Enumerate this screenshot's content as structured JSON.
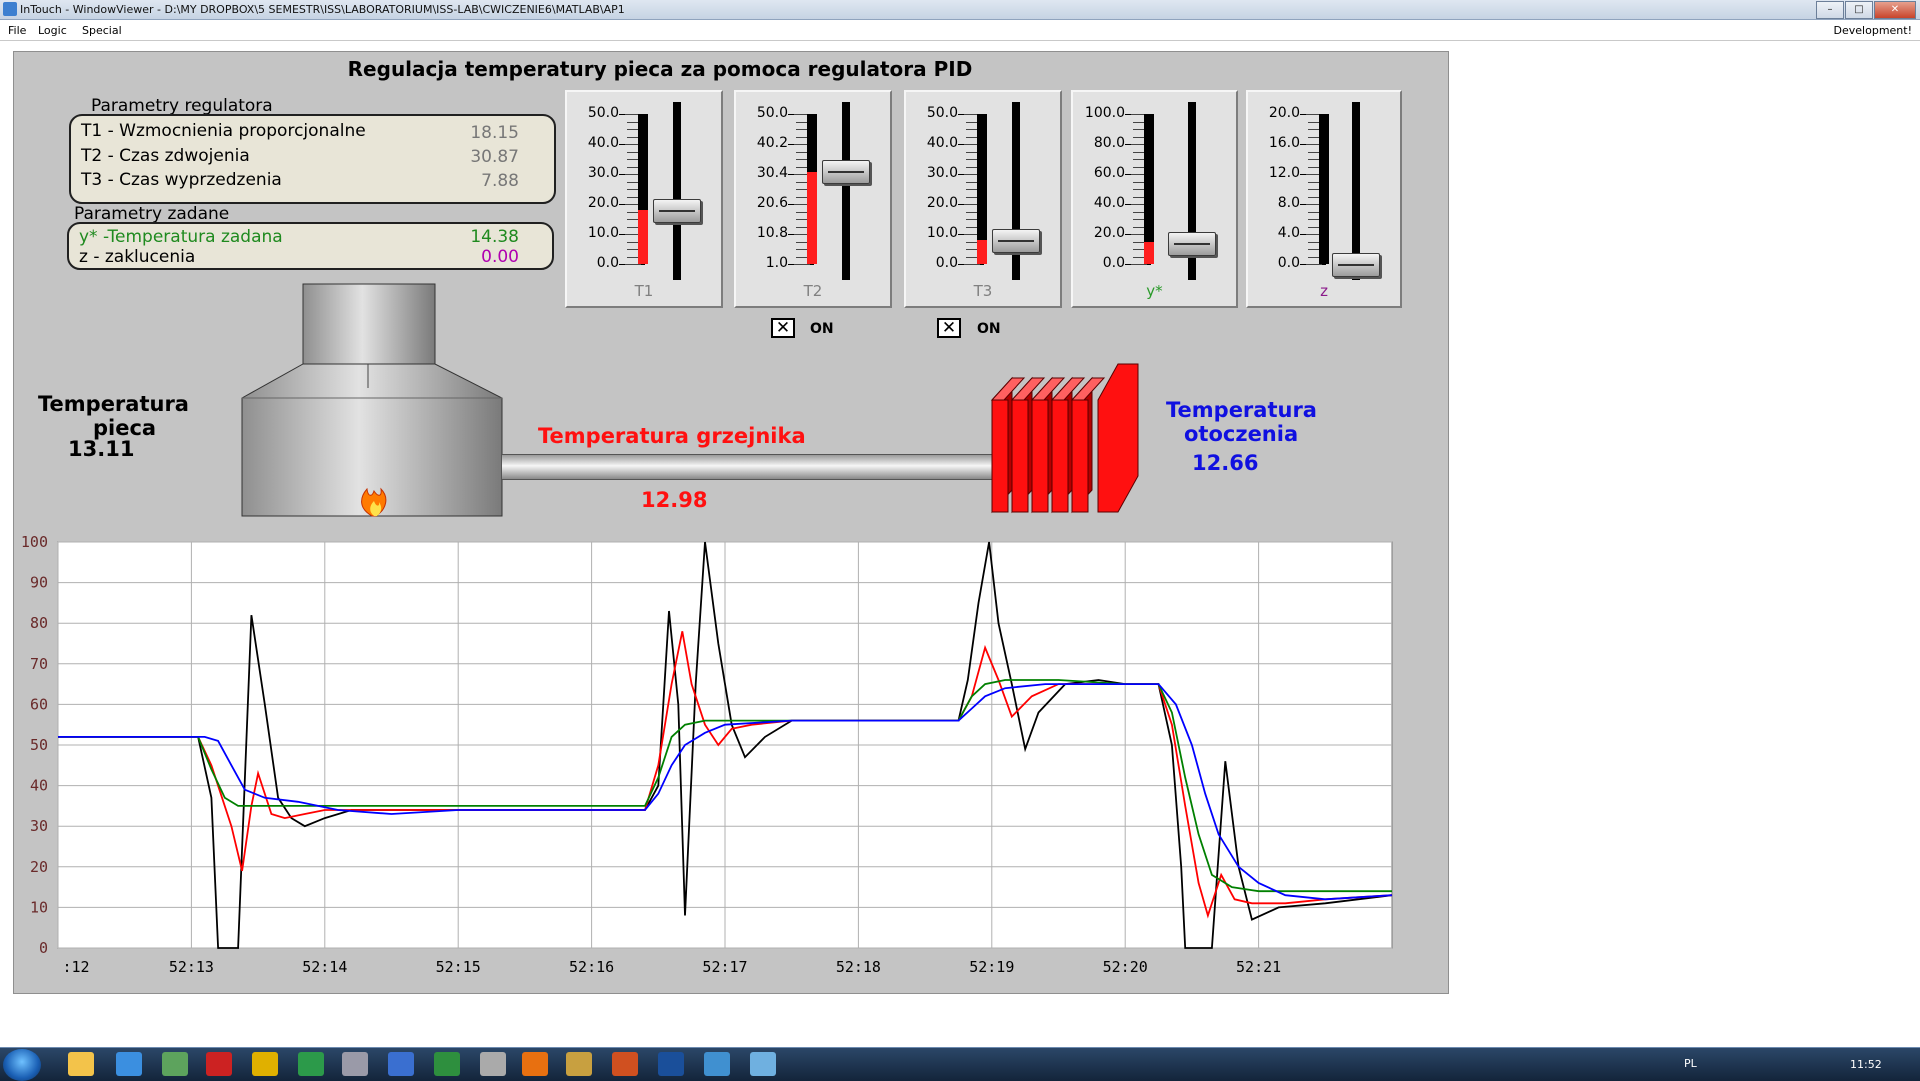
{
  "window": {
    "title": "InTouch - WindowViewer - D:\\MY DROPBOX\\5 SEMESTR\\ISS\\LABORATORIUM\\ISS-LAB\\CWICZENIE6\\MATLAB\\AP1",
    "buttons": [
      "–",
      "□",
      "✕"
    ]
  },
  "menu": {
    "file": "File",
    "logic": "Logic",
    "special": "Special",
    "right": "Development!"
  },
  "main_title": "Regulacja temperatury pieca za pomoca regulatora PID",
  "regulator": {
    "title": "Parametry regulatora",
    "rows": [
      {
        "label": "T1 - Wzmocnienia  proporcjonalne",
        "value": "18.15"
      },
      {
        "label": "T2 - Czas zdwojenia",
        "value": "30.87"
      },
      {
        "label": "T3 - Czas wyprzedzenia",
        "value": "7.88"
      }
    ]
  },
  "setpoints": {
    "title": "Parametry zadane",
    "rows": [
      {
        "label": "y* -Temperatura zadana",
        "value": "14.38"
      },
      {
        "label": "z - zaklucenia",
        "value": "0.00"
      }
    ]
  },
  "sliders": [
    {
      "label": "T1",
      "ticks": [
        "50.0",
        "40.0",
        "30.0",
        "20.0",
        "10.0",
        "0.0"
      ],
      "fill_fraction": 0.363,
      "handle_fraction": 0.36,
      "color": "#808080"
    },
    {
      "label": "T2",
      "ticks": [
        "50.0",
        "40.2",
        "30.4",
        "20.6",
        "10.8",
        "1.0"
      ],
      "fill_fraction": 0.61,
      "handle_fraction": 0.62,
      "color": "#808080"
    },
    {
      "label": "T3",
      "ticks": [
        "50.0",
        "40.0",
        "30.0",
        "20.0",
        "10.0",
        "0.0"
      ],
      "fill_fraction": 0.158,
      "handle_fraction": 0.16,
      "color": "#808080"
    },
    {
      "label": "y*",
      "ticks": [
        "100.0",
        "80.0",
        "60.0",
        "40.0",
        "20.0",
        "0.0"
      ],
      "fill_fraction": 0.144,
      "handle_fraction": 0.14,
      "color": "#2a9a2a"
    },
    {
      "label": "z",
      "ticks": [
        "20.0",
        "16.0",
        "12.0",
        "8.0",
        "4.0",
        "0.0"
      ],
      "fill_fraction": 0.0,
      "handle_fraction": 0.0,
      "color": "#8b1a8b"
    }
  ],
  "toggles": [
    {
      "mark": "✕",
      "label": "ON"
    },
    {
      "mark": "✕",
      "label": "ON"
    }
  ],
  "furnace": {
    "title_line1": "Temperatura",
    "title_line2": "pieca",
    "value": "13.11",
    "flame_icon": "flame-icon"
  },
  "heater": {
    "title": "Temperatura grzejnika",
    "value": "12.98",
    "color": "#ff1010"
  },
  "ambient": {
    "title_line1": "Temperatura",
    "title_line2": "otoczenia",
    "value": "12.66",
    "color": "#1010e0"
  },
  "chart_data": {
    "type": "line",
    "ylim": [
      0,
      100
    ],
    "yticks": [
      0,
      10,
      20,
      30,
      40,
      50,
      60,
      70,
      80,
      90,
      100
    ],
    "xlim": [
      0,
      10
    ],
    "xtick_labels": [
      ":12",
      "52:13",
      "52:14",
      "52:15",
      "52:16",
      "52:17",
      "52:18",
      "52:19",
      "52:20",
      "52:21"
    ],
    "grid": true,
    "series": [
      {
        "color": "#000000",
        "points": [
          [
            0,
            52
          ],
          [
            1.05,
            52
          ],
          [
            1.15,
            37
          ],
          [
            1.2,
            0
          ],
          [
            1.35,
            0
          ],
          [
            1.45,
            82
          ],
          [
            1.55,
            60
          ],
          [
            1.65,
            37
          ],
          [
            1.75,
            32
          ],
          [
            1.85,
            30
          ],
          [
            2.0,
            32
          ],
          [
            2.2,
            34
          ],
          [
            3.0,
            34
          ],
          [
            4.0,
            34
          ],
          [
            4.4,
            34
          ],
          [
            4.5,
            40
          ],
          [
            4.58,
            83
          ],
          [
            4.65,
            60
          ],
          [
            4.7,
            8
          ],
          [
            4.78,
            65
          ],
          [
            4.85,
            100
          ],
          [
            4.95,
            75
          ],
          [
            5.05,
            55
          ],
          [
            5.15,
            47
          ],
          [
            5.3,
            52
          ],
          [
            5.5,
            56
          ],
          [
            6.0,
            56
          ],
          [
            6.5,
            56
          ],
          [
            6.75,
            56
          ],
          [
            6.82,
            66
          ],
          [
            6.9,
            85
          ],
          [
            6.98,
            100
          ],
          [
            7.05,
            80
          ],
          [
            7.15,
            65
          ],
          [
            7.25,
            49
          ],
          [
            7.35,
            58
          ],
          [
            7.55,
            65
          ],
          [
            7.8,
            66
          ],
          [
            8.0,
            65
          ],
          [
            8.25,
            65
          ],
          [
            8.35,
            50
          ],
          [
            8.42,
            20
          ],
          [
            8.45,
            0
          ],
          [
            8.65,
            0
          ],
          [
            8.75,
            46
          ],
          [
            8.85,
            20
          ],
          [
            8.95,
            7
          ],
          [
            9.15,
            10
          ],
          [
            9.5,
            11
          ],
          [
            10,
            13
          ]
        ]
      },
      {
        "color": "#ff0000",
        "points": [
          [
            0,
            52
          ],
          [
            1.05,
            52
          ],
          [
            1.15,
            45
          ],
          [
            1.3,
            30
          ],
          [
            1.38,
            19
          ],
          [
            1.45,
            35
          ],
          [
            1.5,
            43
          ],
          [
            1.6,
            33
          ],
          [
            1.7,
            32
          ],
          [
            1.85,
            33
          ],
          [
            2.0,
            34
          ],
          [
            3.0,
            34
          ],
          [
            4.0,
            34
          ],
          [
            4.4,
            34
          ],
          [
            4.5,
            45
          ],
          [
            4.6,
            65
          ],
          [
            4.68,
            78
          ],
          [
            4.75,
            65
          ],
          [
            4.85,
            55
          ],
          [
            4.95,
            50
          ],
          [
            5.05,
            54
          ],
          [
            5.2,
            55
          ],
          [
            5.5,
            56
          ],
          [
            6.0,
            56
          ],
          [
            6.75,
            56
          ],
          [
            6.85,
            62
          ],
          [
            6.95,
            74
          ],
          [
            7.05,
            66
          ],
          [
            7.15,
            57
          ],
          [
            7.3,
            62
          ],
          [
            7.5,
            65
          ],
          [
            8.0,
            65
          ],
          [
            8.25,
            65
          ],
          [
            8.35,
            55
          ],
          [
            8.45,
            35
          ],
          [
            8.55,
            16
          ],
          [
            8.62,
            8
          ],
          [
            8.72,
            18
          ],
          [
            8.82,
            12
          ],
          [
            8.95,
            11
          ],
          [
            9.2,
            11
          ],
          [
            9.5,
            12
          ],
          [
            10,
            13
          ]
        ]
      },
      {
        "color": "#008000",
        "points": [
          [
            0,
            52
          ],
          [
            1.05,
            52
          ],
          [
            1.15,
            44
          ],
          [
            1.25,
            37
          ],
          [
            1.35,
            35
          ],
          [
            1.6,
            35
          ],
          [
            2.0,
            35
          ],
          [
            3.0,
            35
          ],
          [
            4.0,
            35
          ],
          [
            4.4,
            35
          ],
          [
            4.5,
            42
          ],
          [
            4.6,
            52
          ],
          [
            4.7,
            55
          ],
          [
            4.85,
            56
          ],
          [
            5.0,
            56
          ],
          [
            5.5,
            56
          ],
          [
            6.0,
            56
          ],
          [
            6.75,
            56
          ],
          [
            6.85,
            62
          ],
          [
            6.95,
            65
          ],
          [
            7.1,
            66
          ],
          [
            7.5,
            66
          ],
          [
            8.0,
            65
          ],
          [
            8.25,
            65
          ],
          [
            8.35,
            58
          ],
          [
            8.45,
            42
          ],
          [
            8.55,
            28
          ],
          [
            8.65,
            18
          ],
          [
            8.8,
            15
          ],
          [
            9.0,
            14
          ],
          [
            9.5,
            14
          ],
          [
            10,
            14
          ]
        ]
      },
      {
        "color": "#0000ff",
        "points": [
          [
            0,
            52
          ],
          [
            1.1,
            52
          ],
          [
            1.2,
            51
          ],
          [
            1.3,
            45
          ],
          [
            1.4,
            39
          ],
          [
            1.55,
            37
          ],
          [
            1.8,
            36
          ],
          [
            2.1,
            34
          ],
          [
            2.5,
            33
          ],
          [
            3.0,
            34
          ],
          [
            4.0,
            34
          ],
          [
            4.4,
            34
          ],
          [
            4.5,
            38
          ],
          [
            4.6,
            45
          ],
          [
            4.7,
            50
          ],
          [
            4.85,
            53
          ],
          [
            5.0,
            55
          ],
          [
            5.5,
            56
          ],
          [
            6.0,
            56
          ],
          [
            6.75,
            56
          ],
          [
            6.85,
            59
          ],
          [
            6.95,
            62
          ],
          [
            7.1,
            64
          ],
          [
            7.4,
            65
          ],
          [
            7.8,
            65
          ],
          [
            8.25,
            65
          ],
          [
            8.38,
            60
          ],
          [
            8.5,
            50
          ],
          [
            8.6,
            38
          ],
          [
            8.7,
            28
          ],
          [
            8.85,
            20
          ],
          [
            9.0,
            16
          ],
          [
            9.2,
            13
          ],
          [
            9.5,
            12
          ],
          [
            10,
            13
          ]
        ]
      }
    ]
  },
  "taskbar": {
    "icons": [
      "explorer-icon",
      "dropbox-icon",
      "monitor-icon",
      "app-h-icon",
      "chrome-icon",
      "utorrent-icon",
      "tool-icon",
      "shield-icon",
      "vim-icon",
      "totalcmd-icon",
      "firefox-icon",
      "gimp-icon",
      "matlab-icon",
      "photoshop-icon",
      "network-icon",
      "intouch-icon"
    ],
    "lang": "PL",
    "time": "11:52"
  }
}
